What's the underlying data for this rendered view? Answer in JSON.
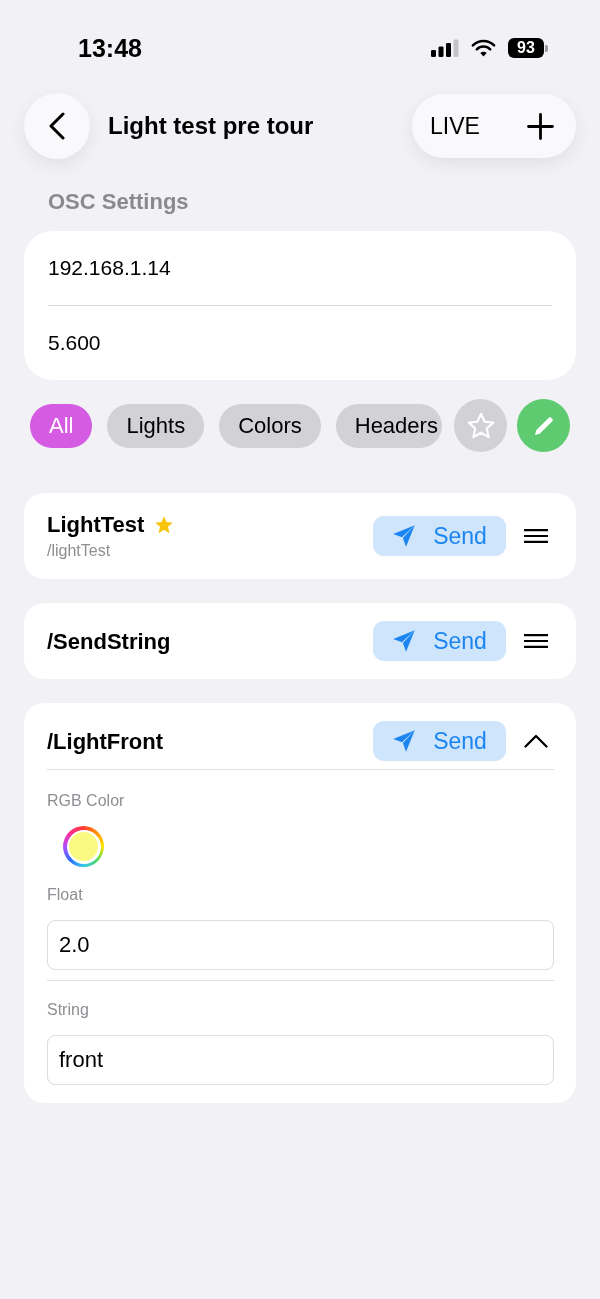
{
  "status_bar": {
    "time": "13:48",
    "battery": "93"
  },
  "nav": {
    "title": "Light test pre tour",
    "live_label": "LIVE"
  },
  "osc_settings": {
    "heading": "OSC Settings",
    "fields": [
      {
        "value": "192.168.1.14"
      },
      {
        "value": "5.600"
      }
    ]
  },
  "filters": {
    "chips": [
      {
        "label": "All",
        "selected": true
      },
      {
        "label": "Lights",
        "selected": false
      },
      {
        "label": "Colors",
        "selected": false
      },
      {
        "label": "Headers",
        "selected": false
      }
    ],
    "favorites_button": {
      "selected": false
    }
  },
  "messages": [
    {
      "title": "LightTest",
      "favorite": true,
      "address": "/lightTest",
      "send_label": "Send",
      "expanded": false
    },
    {
      "title": "/SendString",
      "favorite": false,
      "send_label": "Send",
      "expanded": false
    },
    {
      "title": "/LightFront",
      "favorite": false,
      "send_label": "Send",
      "expanded": true,
      "arguments": [
        {
          "kind": "color",
          "label": "RGB Color",
          "color": "#fafa82"
        },
        {
          "kind": "float",
          "label": "Float",
          "value": "2.0"
        },
        {
          "kind": "string",
          "label": "String",
          "value": "front"
        }
      ]
    }
  ]
}
